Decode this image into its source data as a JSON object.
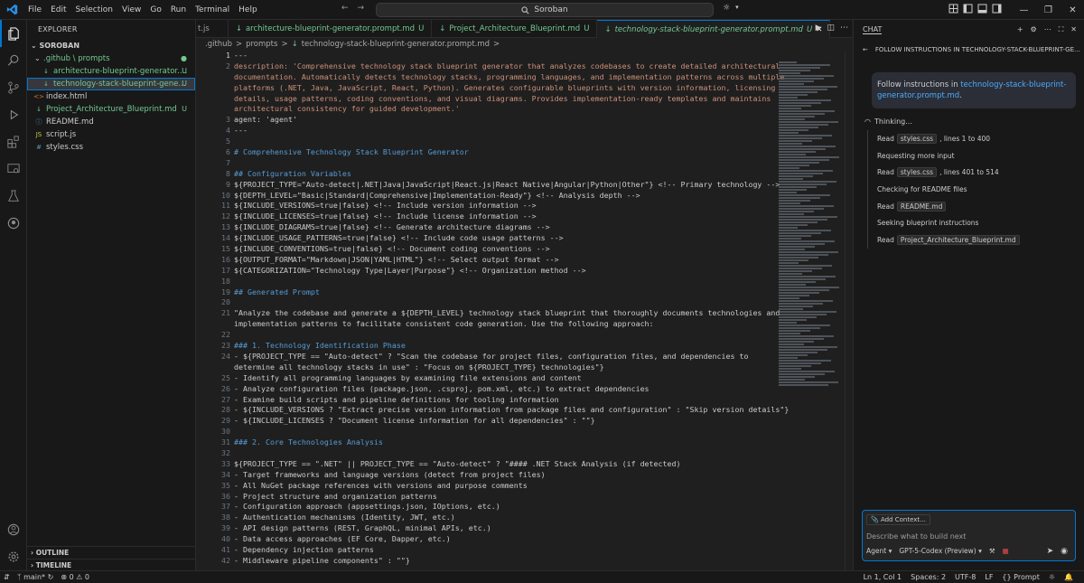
{
  "menu": [
    "File",
    "Edit",
    "Selection",
    "View",
    "Go",
    "Run",
    "Terminal",
    "Help"
  ],
  "search": {
    "label": "Soroban"
  },
  "explorer": {
    "title": "EXPLORER",
    "root": "SOROBAN",
    "items": [
      {
        "label": ".github \\ prompts",
        "badge": "",
        "kind": "folder"
      },
      {
        "label": "architecture-blueprint-generator.prom...",
        "badge": "U",
        "kind": "md"
      },
      {
        "label": "technology-stack-blueprint-generator....",
        "badge": "U",
        "kind": "md"
      },
      {
        "label": "index.html",
        "badge": "",
        "kind": "html"
      },
      {
        "label": "Project_Architecture_Blueprint.md",
        "badge": "U",
        "kind": "md"
      },
      {
        "label": "README.md",
        "badge": "",
        "kind": "md"
      },
      {
        "label": "script.js",
        "badge": "",
        "kind": "js"
      },
      {
        "label": "styles.css",
        "badge": "",
        "kind": "css"
      }
    ],
    "outline": "OUTLINE",
    "timeline": "TIMELINE"
  },
  "tabs": [
    {
      "label": "t.js",
      "mod": ""
    },
    {
      "label": "architecture-blueprint-generator.prompt.md",
      "mod": "U"
    },
    {
      "label": "Project_Architecture_Blueprint.md",
      "mod": "U"
    },
    {
      "label": "technology-stack-blueprint-generator.prompt.md",
      "mod": "U"
    }
  ],
  "breadcrumb": [
    ".github",
    ">",
    "prompts",
    ">",
    "technology-stack-blueprint-generator.prompt.md",
    ">"
  ],
  "editor": {
    "lines": [
      {
        "n": "1",
        "t": "---"
      },
      {
        "n": "2",
        "t": "description: 'Comprehensive technology stack blueprint generator that analyzes codebases to create detailed architectural"
      },
      {
        "n": "",
        "t": "documentation. Automatically detects technology stacks, programming languages, and implementation patterns across multiple"
      },
      {
        "n": "",
        "t": "platforms (.NET, Java, JavaScript, React, Python). Generates configurable blueprints with version information, licensing"
      },
      {
        "n": "",
        "t": "details, usage patterns, coding conventions, and visual diagrams. Provides implementation-ready templates and maintains"
      },
      {
        "n": "",
        "t": "architectural consistency for guided development.'"
      },
      {
        "n": "3",
        "t": "agent: 'agent'"
      },
      {
        "n": "4",
        "t": "---"
      },
      {
        "n": "5",
        "t": ""
      },
      {
        "n": "6",
        "t": "# Comprehensive Technology Stack Blueprint Generator"
      },
      {
        "n": "7",
        "t": ""
      },
      {
        "n": "8",
        "t": "## Configuration Variables"
      },
      {
        "n": "9",
        "t": "${PROJECT_TYPE=\"Auto-detect|.NET|Java|JavaScript|React.js|React Native|Angular|Python|Other\"} <!-- Primary technology -->"
      },
      {
        "n": "10",
        "t": "${DEPTH_LEVEL=\"Basic|Standard|Comprehensive|Implementation-Ready\"} <!-- Analysis depth -->"
      },
      {
        "n": "11",
        "t": "${INCLUDE_VERSIONS=true|false} <!-- Include version information -->"
      },
      {
        "n": "12",
        "t": "${INCLUDE_LICENSES=true|false} <!-- Include license information -->"
      },
      {
        "n": "13",
        "t": "${INCLUDE_DIAGRAMS=true|false} <!-- Generate architecture diagrams -->"
      },
      {
        "n": "14",
        "t": "${INCLUDE_USAGE_PATTERNS=true|false} <!-- Include code usage patterns -->"
      },
      {
        "n": "15",
        "t": "${INCLUDE_CONVENTIONS=true|false} <!-- Document coding conventions -->"
      },
      {
        "n": "16",
        "t": "${OUTPUT_FORMAT=\"Markdown|JSON|YAML|HTML\"} <!-- Select output format -->"
      },
      {
        "n": "17",
        "t": "${CATEGORIZATION=\"Technology Type|Layer|Purpose\"} <!-- Organization method -->"
      },
      {
        "n": "18",
        "t": ""
      },
      {
        "n": "19",
        "t": "## Generated Prompt"
      },
      {
        "n": "20",
        "t": ""
      },
      {
        "n": "21",
        "t": "\"Analyze the codebase and generate a ${DEPTH_LEVEL} technology stack blueprint that thoroughly documents technologies and"
      },
      {
        "n": "",
        "t": "implementation patterns to facilitate consistent code generation. Use the following approach:"
      },
      {
        "n": "22",
        "t": ""
      },
      {
        "n": "23",
        "t": "### 1. Technology Identification Phase"
      },
      {
        "n": "24",
        "t": "- ${PROJECT_TYPE == \"Auto-detect\" ? \"Scan the codebase for project files, configuration files, and dependencies to"
      },
      {
        "n": "",
        "t": "determine all technology stacks in use\" : \"Focus on ${PROJECT_TYPE} technologies\"}"
      },
      {
        "n": "25",
        "t": "- Identify all programming languages by examining file extensions and content"
      },
      {
        "n": "26",
        "t": "- Analyze configuration files (package.json, .csproj, pom.xml, etc.) to extract dependencies"
      },
      {
        "n": "27",
        "t": "- Examine build scripts and pipeline definitions for tooling information"
      },
      {
        "n": "28",
        "t": "- ${INCLUDE_VERSIONS ? \"Extract precise version information from package files and configuration\" : \"Skip version details\"}"
      },
      {
        "n": "29",
        "t": "- ${INCLUDE_LICENSES ? \"Document license information for all dependencies\" : \"\"}"
      },
      {
        "n": "30",
        "t": ""
      },
      {
        "n": "31",
        "t": "### 2. Core Technologies Analysis"
      },
      {
        "n": "32",
        "t": ""
      },
      {
        "n": "33",
        "t": "${PROJECT_TYPE == \".NET\" || PROJECT_TYPE == \"Auto-detect\" ? \"#### .NET Stack Analysis (if detected)"
      },
      {
        "n": "34",
        "t": "- Target frameworks and language versions (detect from project files)"
      },
      {
        "n": "35",
        "t": "- All NuGet package references with versions and purpose comments"
      },
      {
        "n": "36",
        "t": "- Project structure and organization patterns"
      },
      {
        "n": "37",
        "t": "- Configuration approach (appsettings.json, IOptions, etc.)"
      },
      {
        "n": "38",
        "t": "- Authentication mechanisms (Identity, JWT, etc.)"
      },
      {
        "n": "39",
        "t": "- API design patterns (REST, GraphQL, minimal APIs, etc.)"
      },
      {
        "n": "40",
        "t": "- Data access approaches (EF Core, Dapper, etc.)"
      },
      {
        "n": "41",
        "t": "- Dependency injection patterns"
      },
      {
        "n": "42",
        "t": "- Middleware pipeline components\" : \"\"}"
      }
    ]
  },
  "chat": {
    "tab": "CHAT",
    "subtitle": "FOLLOW INSTRUCTIONS IN TECHNOLOGY-STACK-BLUEPRINT-GE...",
    "user_msg_prefix": "Follow instructions in ",
    "user_msg_link": "technology-stack-blueprint-generator.prompt.md",
    "user_msg_suffix": ".",
    "thinking": "Thinking...",
    "steps": [
      {
        "verb": "Read",
        "chip": "styles.css",
        "rest": ", lines 1 to 400"
      },
      {
        "verb": "Requesting more input",
        "chip": "",
        "rest": ""
      },
      {
        "verb": "Read",
        "chip": "styles.css",
        "rest": ", lines 401 to 514"
      },
      {
        "verb": "Checking for README files",
        "chip": "",
        "rest": ""
      },
      {
        "verb": "Read",
        "chip": "README.md",
        "rest": ""
      },
      {
        "verb": "Seeking blueprint instructions",
        "chip": "",
        "rest": ""
      },
      {
        "verb": "Read",
        "chip": "Project_Architecture_Blueprint.md",
        "rest": ""
      }
    ],
    "add_context": "Add Context...",
    "placeholder": "Describe what to build next",
    "mode": "Agent",
    "model": "GPT-5-Codex (Preview)"
  },
  "status": {
    "branch": "main*",
    "errors": "0",
    "warnings": "0",
    "cursor": "Ln 1, Col 1",
    "spaces": "Spaces: 2",
    "encoding": "UTF-8",
    "eol": "LF",
    "language": "Prompt"
  }
}
